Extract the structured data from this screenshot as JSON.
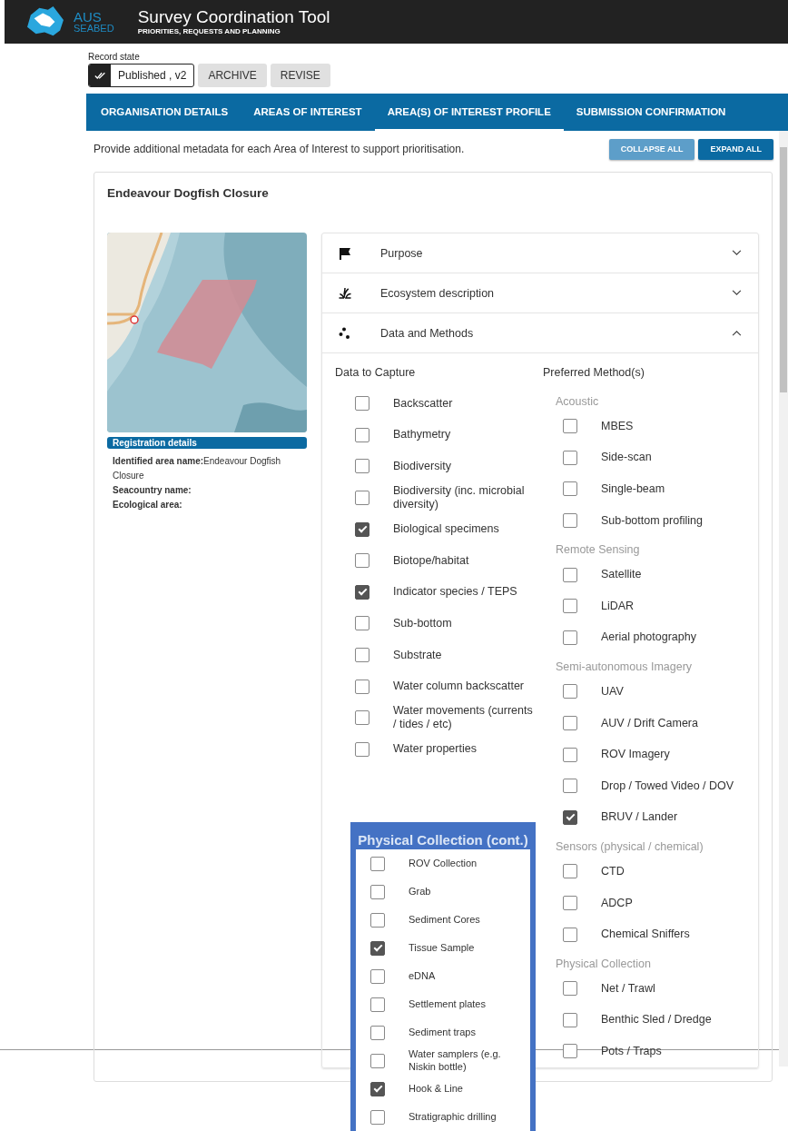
{
  "header": {
    "logo_top": "AUS",
    "logo_bottom": "SEABED",
    "title": "Survey Coordination Tool",
    "subtitle": "PRIORITIES, REQUESTS AND PLANNING"
  },
  "record_state": {
    "label": "Record state",
    "value": "Published , v2",
    "buttons": [
      "ARCHIVE",
      "REVISE"
    ]
  },
  "tabs": [
    {
      "label": "ORGANISATION DETAILS",
      "selected": false
    },
    {
      "label": "AREAS OF INTEREST",
      "selected": false
    },
    {
      "label": "AREA(S) OF INTEREST PROFILE",
      "selected": true
    },
    {
      "label": "SUBMISSION CONFIRMATION",
      "selected": false
    }
  ],
  "intro": "Provide additional metadata for each Area of Interest to support prioritisation.",
  "actions": [
    {
      "label": "COLLAPSE ALL",
      "disabled": true
    },
    {
      "label": "EXPAND ALL",
      "disabled": false
    }
  ],
  "card": {
    "title": "Endeavour Dogfish Closure",
    "registration": {
      "heading": "Registration details",
      "fields": [
        {
          "label": "Identified area name:",
          "value": "Endeavour Dogfish Closure"
        },
        {
          "label": "Seacountry name:"
        },
        {
          "label": "Ecological area:"
        }
      ]
    }
  },
  "sections": [
    {
      "title": "Purpose",
      "kind": "flag",
      "expanded": false
    },
    {
      "title": "Ecosystem description",
      "kind": "plant",
      "expanded": false
    },
    {
      "title": "Data and Methods",
      "kind": "dots",
      "expanded": true
    }
  ],
  "data_to_capture": {
    "heading": "Data to Capture",
    "items": [
      {
        "label": "Backscatter",
        "checked": false
      },
      {
        "label": "Bathymetry",
        "checked": false
      },
      {
        "label": "Biodiversity",
        "checked": false
      },
      {
        "label": "Biodiversity (inc. microbial diversity)",
        "checked": false
      },
      {
        "label": "Biological specimens",
        "checked": true
      },
      {
        "label": "Biotope/habitat",
        "checked": false
      },
      {
        "label": "Indicator species / TEPS",
        "checked": true
      },
      {
        "label": "Sub-bottom",
        "checked": false
      },
      {
        "label": "Substrate",
        "checked": false
      },
      {
        "label": "Water column backscatter",
        "checked": false
      },
      {
        "label": "Water movements (currents / tides / etc)",
        "checked": false
      },
      {
        "label": "Water properties",
        "checked": false
      }
    ]
  },
  "preferred_methods": {
    "heading": "Preferred Method(s)",
    "groups": [
      {
        "name": "Acoustic",
        "items": [
          {
            "label": "MBES",
            "checked": false
          },
          {
            "label": "Side-scan",
            "checked": false
          },
          {
            "label": "Single-beam",
            "checked": false
          },
          {
            "label": "Sub-bottom profiling",
            "checked": false
          }
        ]
      },
      {
        "name": "Remote Sensing",
        "items": [
          {
            "label": "Satellite",
            "checked": false
          },
          {
            "label": "LiDAR",
            "checked": false
          },
          {
            "label": "Aerial photography",
            "checked": false
          }
        ]
      },
      {
        "name": "Semi-autonomous Imagery",
        "items": [
          {
            "label": "UAV",
            "checked": false
          },
          {
            "label": "AUV / Drift Camera",
            "checked": false
          },
          {
            "label": "ROV Imagery",
            "checked": false
          },
          {
            "label": "Drop / Towed Video / DOV",
            "checked": false
          },
          {
            "label": "BRUV / Lander",
            "checked": true
          }
        ]
      },
      {
        "name": "Sensors (physical / chemical)",
        "items": [
          {
            "label": "CTD",
            "checked": false
          },
          {
            "label": "ADCP",
            "checked": false
          },
          {
            "label": "Chemical Sniffers",
            "checked": false
          }
        ]
      },
      {
        "name": "Physical Collection",
        "items": [
          {
            "label": "Net / Trawl",
            "checked": false
          },
          {
            "label": "Benthic Sled / Dredge",
            "checked": false
          },
          {
            "label": "Pots / Traps",
            "checked": false
          }
        ]
      }
    ]
  },
  "inset": {
    "title": "Physical Collection (cont.)",
    "items": [
      {
        "label": "ROV Collection",
        "checked": false
      },
      {
        "label": "Grab",
        "checked": false
      },
      {
        "label": "Sediment Cores",
        "checked": false
      },
      {
        "label": "Tissue Sample",
        "checked": true
      },
      {
        "label": "eDNA",
        "checked": false
      },
      {
        "label": "Settlement plates",
        "checked": false
      },
      {
        "label": "Sediment traps",
        "checked": false
      },
      {
        "label": "Water samplers (e.g. Niskin bottle)",
        "checked": false
      },
      {
        "label": "Hook & Line",
        "checked": true
      },
      {
        "label": "Stratigraphic drilling",
        "checked": false
      }
    ]
  }
}
